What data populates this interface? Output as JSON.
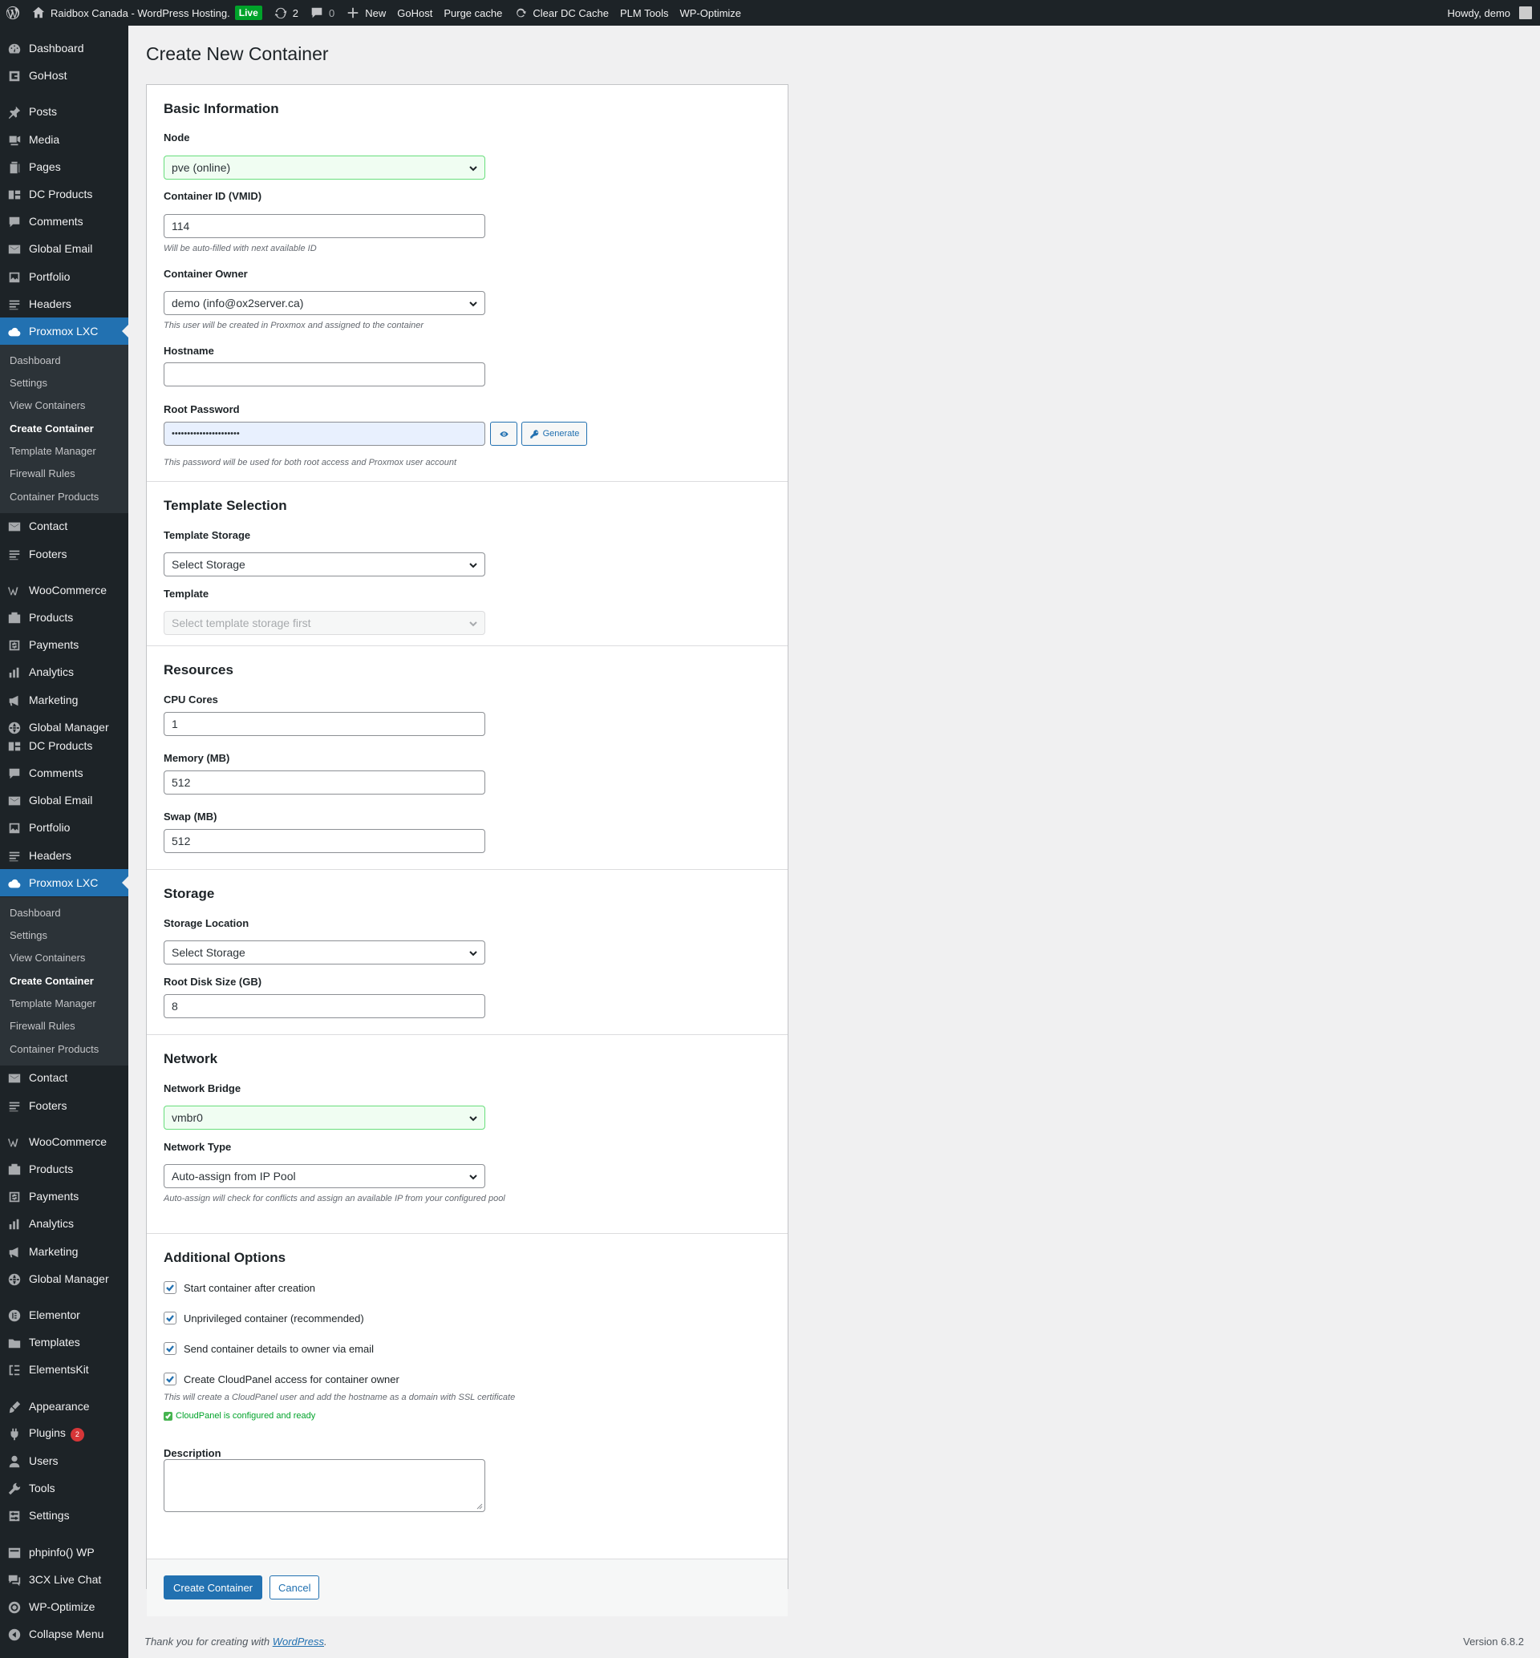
{
  "adminbar": {
    "site_name": "Raidbox Canada - WordPress Hosting.",
    "live_badge": "Live",
    "updates_count": "2",
    "comments_count": "0",
    "new_label": "New",
    "gohost_label": "GoHost",
    "purge_label": "Purge cache",
    "clear_dc_label": "Clear DC Cache",
    "plm_label": "PLM Tools",
    "wpoptimize_label": "WP-Optimize",
    "howdy": "Howdy, demo"
  },
  "sidebar": {
    "menu": [
      {
        "label": "Dashboard",
        "icon": "dashboard-icon"
      },
      {
        "label": "GoHost",
        "icon": "gohost-icon"
      },
      {
        "label": "Posts",
        "icon": "pin-icon"
      },
      {
        "label": "Media",
        "icon": "media-icon"
      },
      {
        "label": "Pages",
        "icon": "pages-icon"
      },
      {
        "label": "DC Products",
        "icon": "dc-products-icon"
      },
      {
        "label": "Comments",
        "icon": "comment-icon"
      },
      {
        "label": "Global Email",
        "icon": "email-icon"
      },
      {
        "label": "Portfolio",
        "icon": "portfolio-icon"
      },
      {
        "label": "Headers",
        "icon": "headers-icon"
      },
      {
        "label": "Proxmox LXC",
        "icon": "cloud-icon"
      },
      {
        "label": "Contact",
        "icon": "contact-icon"
      },
      {
        "label": "Footers",
        "icon": "footers-icon"
      },
      {
        "label": "WooCommerce",
        "icon": "woocommerce-icon"
      },
      {
        "label": "Products",
        "icon": "products-icon"
      },
      {
        "label": "Payments",
        "icon": "payments-icon"
      },
      {
        "label": "Analytics",
        "icon": "analytics-icon"
      },
      {
        "label": "Marketing",
        "icon": "megaphone-icon"
      },
      {
        "label": "Global Manager",
        "icon": "globe-icon"
      },
      {
        "label": "DC Products",
        "icon": "dc-products-icon"
      },
      {
        "label": "Comments",
        "icon": "comment-icon"
      },
      {
        "label": "Global Email",
        "icon": "email-icon"
      },
      {
        "label": "Portfolio",
        "icon": "portfolio-icon"
      },
      {
        "label": "Headers",
        "icon": "headers-icon"
      },
      {
        "label": "Proxmox LXC",
        "icon": "cloud-icon"
      },
      {
        "label": "Contact",
        "icon": "contact-icon"
      },
      {
        "label": "Footers",
        "icon": "footers-icon"
      },
      {
        "label": "WooCommerce",
        "icon": "woocommerce-icon"
      },
      {
        "label": "Products",
        "icon": "products-icon"
      },
      {
        "label": "Payments",
        "icon": "payments-icon"
      },
      {
        "label": "Analytics",
        "icon": "analytics-icon"
      },
      {
        "label": "Marketing",
        "icon": "megaphone-icon"
      },
      {
        "label": "Global Manager",
        "icon": "globe-icon"
      },
      {
        "label": "Elementor",
        "icon": "elementor-icon"
      },
      {
        "label": "Templates",
        "icon": "folder-icon"
      },
      {
        "label": "ElementsKit",
        "icon": "elementskit-icon"
      },
      {
        "label": "Appearance",
        "icon": "brush-icon"
      },
      {
        "label": "Plugins",
        "icon": "plugin-icon",
        "badge": "2"
      },
      {
        "label": "Users",
        "icon": "user-icon"
      },
      {
        "label": "Tools",
        "icon": "wrench-icon"
      },
      {
        "label": "Settings",
        "icon": "settings-icon"
      },
      {
        "label": "phpinfo() WP",
        "icon": "phpinfo-icon"
      },
      {
        "label": "3CX Live Chat",
        "icon": "chat-icon"
      },
      {
        "label": "WP-Optimize",
        "icon": "wpoptimize-icon"
      },
      {
        "label": "Collapse Menu",
        "icon": "collapse-icon"
      }
    ],
    "submenu": [
      "Dashboard",
      "Settings",
      "View Containers",
      "Create Container",
      "Template Manager",
      "Firewall Rules",
      "Container Products"
    ]
  },
  "page": {
    "title": "Create New Container",
    "sections": {
      "basic": "Basic Information",
      "template": "Template Selection",
      "resources": "Resources",
      "storage": "Storage",
      "network": "Network",
      "options": "Additional Options"
    },
    "fields": {
      "node_label": "Node",
      "node_value": "pve (online)",
      "vmid_label": "Container ID (VMID)",
      "vmid_value": "114",
      "vmid_desc": "Will be auto-filled with next available ID",
      "owner_label": "Container Owner",
      "owner_value": "demo (info@ox2server.ca)",
      "owner_desc": "This user will be created in Proxmox and assigned to the container",
      "hostname_label": "Hostname",
      "hostname_value": "",
      "password_label": "Root Password",
      "password_value": "••••••••••••••••••••••",
      "password_desc": "This password will be used for both root access and Proxmox user account",
      "generate_label": "Generate",
      "tstorage_label": "Template Storage",
      "tstorage_value": "Select Storage",
      "template_label": "Template",
      "template_value": "Select template storage first",
      "cpu_label": "CPU Cores",
      "cpu_value": "1",
      "memory_label": "Memory (MB)",
      "memory_value": "512",
      "swap_label": "Swap (MB)",
      "swap_value": "512",
      "slocation_label": "Storage Location",
      "slocation_value": "Select Storage",
      "disk_label": "Root Disk Size (GB)",
      "disk_value": "8",
      "bridge_label": "Network Bridge",
      "bridge_value": "vmbr0",
      "ntype_label": "Network Type",
      "ntype_value": "Auto-assign from IP Pool",
      "ntype_desc": "Auto-assign will check for conflicts and assign an available IP from your configured pool",
      "opt_start": "Start container after creation",
      "opt_unpriv": "Unprivileged container (recommended)",
      "opt_email": "Send container details to owner via email",
      "opt_cloudpanel": "Create CloudPanel access for container owner",
      "cloudpanel_desc": "This will create a CloudPanel user and add the hostname as a domain with SSL certificate",
      "cloudpanel_ok": "CloudPanel is configured and ready",
      "description_label": "Description"
    },
    "buttons": {
      "create": "Create Container",
      "cancel": "Cancel"
    }
  },
  "footer": {
    "thanks_prefix": "Thank you for creating with ",
    "thanks_link": "WordPress",
    "thanks_suffix": ".",
    "version": "Version 6.8.2"
  }
}
